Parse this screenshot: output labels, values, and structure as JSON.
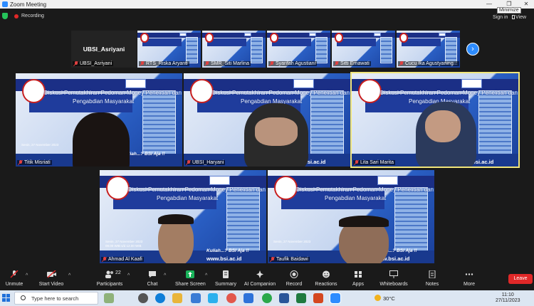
{
  "window": {
    "title": "Zoom Meeting",
    "tooltip": "Minimize",
    "min_glyph": "—",
    "max_glyph": "❐",
    "close_glyph": "✕"
  },
  "meeting_bar": {
    "recording_label": "Recording",
    "sign_in_label": "Sign in",
    "view_label": "View"
  },
  "slide": {
    "title_line1": "Diskusi Pemutakhiran Pedoman Money Penelitian dan",
    "title_line2": "Pengabdian Masyarakat",
    "date_text": "Senin, 27 November 2023",
    "time_text": "09.00 WIB s/d 12.00 WIB",
    "tagline": "Kuliah...? BSI Aja !!",
    "website": "www.bsi.ac.id",
    "university": "UNIVERSITAS",
    "ppm": "PPM"
  },
  "thumbnails": [
    {
      "name": "UBSI_Asriyani",
      "type": "name-only"
    },
    {
      "name": "RTS_Riska Aryanti",
      "type": "slide"
    },
    {
      "name": "SMR_Siti Marlina",
      "type": "slide"
    },
    {
      "name": "Syarifah Agustiani",
      "type": "slide"
    },
    {
      "name": "Sitti Ernawati",
      "type": "slide"
    },
    {
      "name": "Cucu Ika Agustyaning...",
      "type": "slide"
    }
  ],
  "gallery": [
    {
      "name": "Titik Misriati"
    },
    {
      "name": "UBSI_Haryani"
    },
    {
      "name": "Lita Sari Marita"
    },
    {
      "name": "Ahmad Al Kaafi"
    },
    {
      "name": "Taufik Baidawi"
    }
  ],
  "toolbar": {
    "unmute": "Unmute",
    "start_video": "Start Video",
    "participants": "Participants",
    "participants_count": "22",
    "chat": "Chat",
    "share_screen": "Share Screen",
    "summary": "Summary",
    "ai_companion": "AI Companion",
    "record": "Record",
    "reactions": "Reactions",
    "apps": "Apps",
    "whiteboards": "Whiteboards",
    "notes": "Notes",
    "more": "More",
    "leave": "Leave"
  },
  "taskbar": {
    "search_placeholder": "Type here to search",
    "temperature": "30°C",
    "time": "11:10",
    "date": "27/11/2023"
  },
  "colors": {
    "zoom_blue": "#2d8cff",
    "leave_red": "#e02828",
    "share_green": "#1ab35a",
    "active_border": "#f1e57a"
  }
}
